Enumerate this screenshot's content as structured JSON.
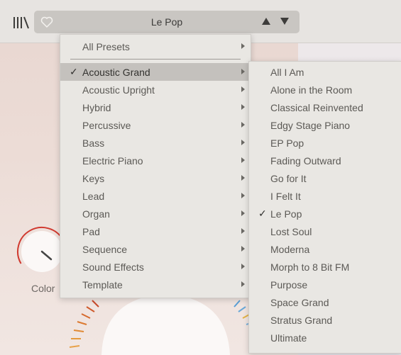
{
  "toolbar": {
    "preset_name": "Le Pop"
  },
  "icons": {
    "library": "library-icon",
    "favorite": "heart-icon",
    "previous": "arrow-up-icon",
    "next": "arrow-down-icon"
  },
  "category_menu": {
    "all_presets": "All Presets",
    "items": [
      {
        "label": "Acoustic Grand",
        "selected": true
      },
      {
        "label": "Acoustic Upright",
        "selected": false
      },
      {
        "label": "Hybrid",
        "selected": false
      },
      {
        "label": "Percussive",
        "selected": false
      },
      {
        "label": "Bass",
        "selected": false
      },
      {
        "label": "Electric Piano",
        "selected": false
      },
      {
        "label": "Keys",
        "selected": false
      },
      {
        "label": "Lead",
        "selected": false
      },
      {
        "label": "Organ",
        "selected": false
      },
      {
        "label": "Pad",
        "selected": false
      },
      {
        "label": "Sequence",
        "selected": false
      },
      {
        "label": "Sound Effects",
        "selected": false
      },
      {
        "label": "Template",
        "selected": false
      }
    ]
  },
  "preset_menu": {
    "items": [
      {
        "label": "All I Am",
        "checked": false
      },
      {
        "label": "Alone in the Room",
        "checked": false
      },
      {
        "label": "Classical Reinvented",
        "checked": false
      },
      {
        "label": "Edgy Stage Piano",
        "checked": false
      },
      {
        "label": "EP Pop",
        "checked": false
      },
      {
        "label": "Fading Outward",
        "checked": false
      },
      {
        "label": "Go for It",
        "checked": false
      },
      {
        "label": "I Felt It",
        "checked": false
      },
      {
        "label": "Le Pop",
        "checked": true
      },
      {
        "label": "Lost Soul",
        "checked": false
      },
      {
        "label": "Moderna",
        "checked": false
      },
      {
        "label": "Morph to 8 Bit FM",
        "checked": false
      },
      {
        "label": "Purpose",
        "checked": false
      },
      {
        "label": "Space Grand",
        "checked": false
      },
      {
        "label": "Stratus Grand",
        "checked": false
      },
      {
        "label": "Ultimate",
        "checked": false
      }
    ]
  },
  "controls": {
    "color_label": "Color"
  },
  "colors": {
    "menu_bg": "#e9e7e3",
    "selected_bg": "#c4c1bd",
    "knob_arc": "#d0392f"
  }
}
